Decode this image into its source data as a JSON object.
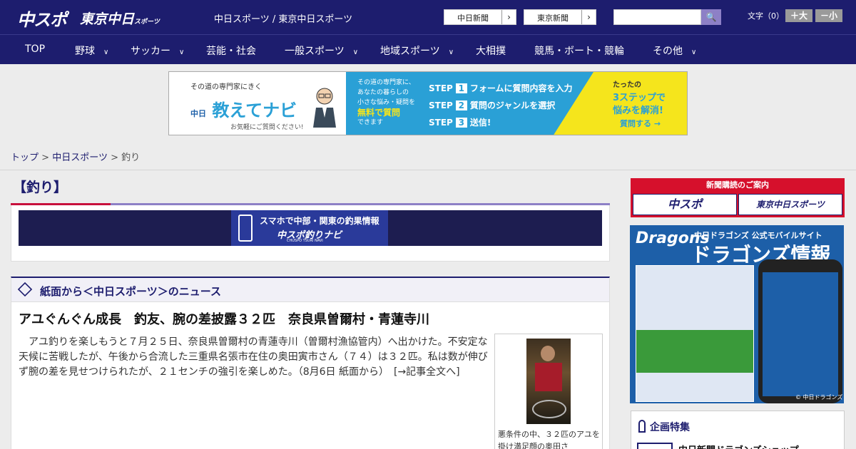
{
  "header": {
    "logo_chuspo": "中スポ",
    "logo_tokyo": "東京中日",
    "logo_tokyo_small": "スポーツ",
    "site_names": "中日スポーツ / 東京中日スポーツ",
    "links": [
      {
        "label": "中日新聞",
        "arrow": "›"
      },
      {
        "label": "東京新聞",
        "arrow": "›"
      }
    ],
    "search": {
      "value": "",
      "placeholder": ""
    },
    "search_icon_glyph": "🔍",
    "font_size_label": "文字（0）",
    "font_bigger": "＋大",
    "font_smaller": "－小"
  },
  "nav": [
    {
      "label": "TOP",
      "has_dropdown": false
    },
    {
      "label": "野球",
      "has_dropdown": true
    },
    {
      "label": "サッカー",
      "has_dropdown": true
    },
    {
      "label": "芸能・社会",
      "has_dropdown": false
    },
    {
      "label": "一般スポーツ",
      "has_dropdown": true
    },
    {
      "label": "地域スポーツ",
      "has_dropdown": true
    },
    {
      "label": "大相撲",
      "has_dropdown": false
    },
    {
      "label": "競馬・ボート・競輪",
      "has_dropdown": false
    },
    {
      "label": "その他",
      "has_dropdown": true
    }
  ],
  "nav_chevron": "∨",
  "ad": {
    "tagline": "その道の専門家にきく",
    "brand_prefix": "中日",
    "title": "教えてナビ",
    "sub": "お気軽にご質問ください!",
    "desc_lines": [
      "その道の専門家に、",
      "あなたの暮らしの",
      "小さな悩み・疑問を"
    ],
    "desc_highlight": "無料で質問",
    "desc_end": "できます",
    "steps": [
      {
        "label": "STEP",
        "num": "1",
        "text": "フォームに質問内容を入力"
      },
      {
        "label": "STEP",
        "num": "2",
        "text": "質問のジャンルを選択"
      },
      {
        "label": "STEP",
        "num": "3",
        "text": "送信!"
      }
    ],
    "cta_lines": [
      "たったの",
      "3ステップで",
      "悩みを解消!"
    ],
    "ask_label": "質問する →"
  },
  "breadcrumb": {
    "items": [
      "トップ",
      "中日スポーツ"
    ],
    "current": "釣り",
    "separator": ">"
  },
  "section_title": "【釣り】",
  "navi_banner": {
    "line1": "スマホで中部・関東の釣果情報",
    "line2": "中スポ釣りナビ",
    "line3": "CHUSPO TSURI NAVI"
  },
  "news_section": {
    "title": "紙面から＜中日スポーツ＞のニュース",
    "headline": "アユぐんぐん成長　釣友、腕の差披露３２匹　奈良県曽爾村・青蓮寺川",
    "body": "　アユ釣りを楽しもうと７月２５日、奈良県曽爾村の青蓮寺川（曽爾村漁協管内）へ出かけた。不安定な天候に苦戦したが、午後から合流した三重県名張市在住の奥田寅市さん（７４）は３２匹。私は数が伸びず腕の差を見せつけられたが、２１センチの強引を楽しめた。（8月6日 紙面から）",
    "more_link": "[→記事全文へ]",
    "caption": "悪条件の中、３２匹のアユを掛け満足顔の奥田さ"
  },
  "sidebar": {
    "subscription_head": "新聞購読のご案内",
    "subscription_buttons": [
      "中スポ",
      "東京中日スポーツ"
    ],
    "dragons": {
      "logo": "Dragons",
      "subtitle": "中日ドラゴンズ 公式モバイルサイト",
      "title": "ドラゴンズ情報",
      "copyright": "© 中日ドラゴンズ"
    },
    "feature_title": "企画特集",
    "feature_item": "中日新聞ドラゴンズショップ"
  },
  "colors": {
    "brand_navy": "#1d1d6e",
    "accent_red": "#c8103c",
    "accent_lavender": "#8d80c6",
    "ad_blue": "#2aa0d6",
    "ad_yellow": "#f5e51c"
  }
}
